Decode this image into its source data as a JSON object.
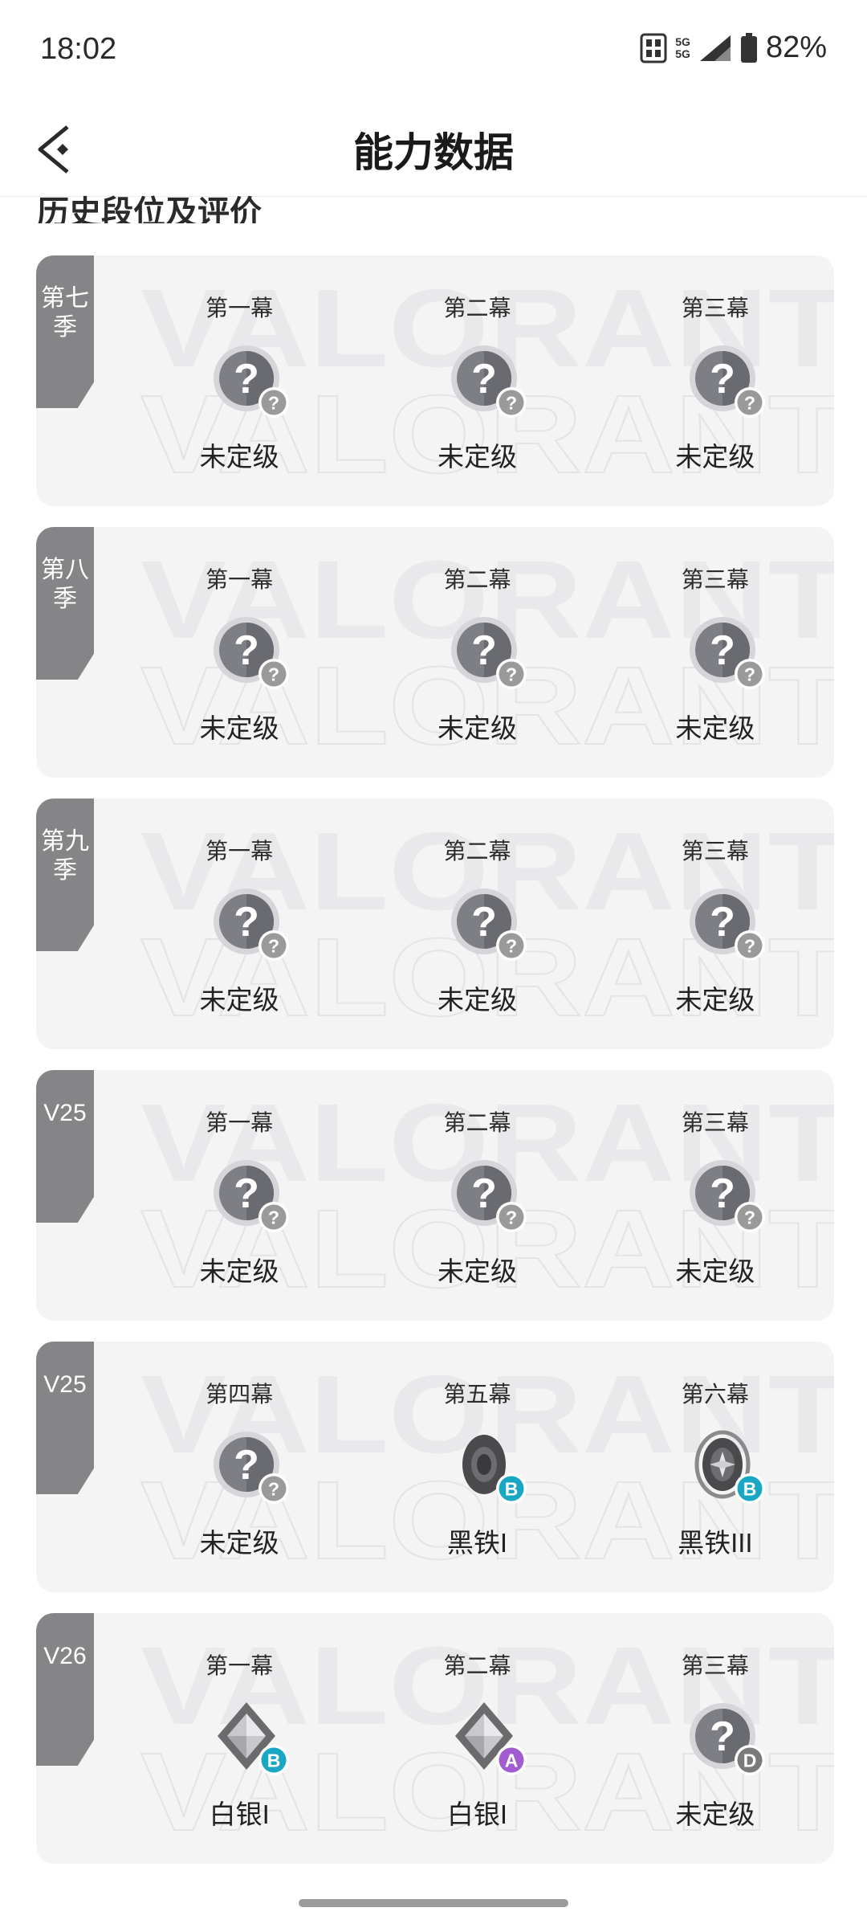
{
  "status_bar": {
    "time": "18:02",
    "net_top": "5G",
    "net_bottom": "5G",
    "battery": "82%",
    "battery_level": 0.82
  },
  "header": {
    "title": "能力数据",
    "back_icon": "back-chevron-icon"
  },
  "section": {
    "title": "历史段位及评价"
  },
  "seasons": [
    {
      "tag": "第七季",
      "acts": [
        {
          "label": "第一幕",
          "rank": "未定级",
          "icon": "unranked",
          "grade": "?"
        },
        {
          "label": "第二幕",
          "rank": "未定级",
          "icon": "unranked",
          "grade": "?"
        },
        {
          "label": "第三幕",
          "rank": "未定级",
          "icon": "unranked",
          "grade": "?"
        }
      ]
    },
    {
      "tag": "第八季",
      "acts": [
        {
          "label": "第一幕",
          "rank": "未定级",
          "icon": "unranked",
          "grade": "?"
        },
        {
          "label": "第二幕",
          "rank": "未定级",
          "icon": "unranked",
          "grade": "?"
        },
        {
          "label": "第三幕",
          "rank": "未定级",
          "icon": "unranked",
          "grade": "?"
        }
      ]
    },
    {
      "tag": "第九季",
      "acts": [
        {
          "label": "第一幕",
          "rank": "未定级",
          "icon": "unranked",
          "grade": "?"
        },
        {
          "label": "第二幕",
          "rank": "未定级",
          "icon": "unranked",
          "grade": "?"
        },
        {
          "label": "第三幕",
          "rank": "未定级",
          "icon": "unranked",
          "grade": "?"
        }
      ]
    },
    {
      "tag": "V25",
      "acts": [
        {
          "label": "第一幕",
          "rank": "未定级",
          "icon": "unranked",
          "grade": "?"
        },
        {
          "label": "第二幕",
          "rank": "未定级",
          "icon": "unranked",
          "grade": "?"
        },
        {
          "label": "第三幕",
          "rank": "未定级",
          "icon": "unranked",
          "grade": "?"
        }
      ]
    },
    {
      "tag": "V25",
      "acts": [
        {
          "label": "第四幕",
          "rank": "未定级",
          "icon": "unranked",
          "grade": "?"
        },
        {
          "label": "第五幕",
          "rank": "黑铁I",
          "icon": "iron-1",
          "grade": "B"
        },
        {
          "label": "第六幕",
          "rank": "黑铁III",
          "icon": "iron-3",
          "grade": "B"
        }
      ]
    },
    {
      "tag": "V26",
      "acts": [
        {
          "label": "第一幕",
          "rank": "白银I",
          "icon": "silver-1",
          "grade": "B"
        },
        {
          "label": "第二幕",
          "rank": "白银I",
          "icon": "silver-1",
          "grade": "A"
        },
        {
          "label": "第三幕",
          "rank": "未定级",
          "icon": "unranked",
          "grade": "D"
        }
      ]
    }
  ],
  "watermark": "VALORANT",
  "colors": {
    "card_bg": "#f4f4f5",
    "season_tag": "#858587",
    "grade_B": "#1aa7c4",
    "grade_A": "#a35bd1",
    "grade_D": "#7a7a7a",
    "grade_unknown": "#9a9a9a"
  }
}
